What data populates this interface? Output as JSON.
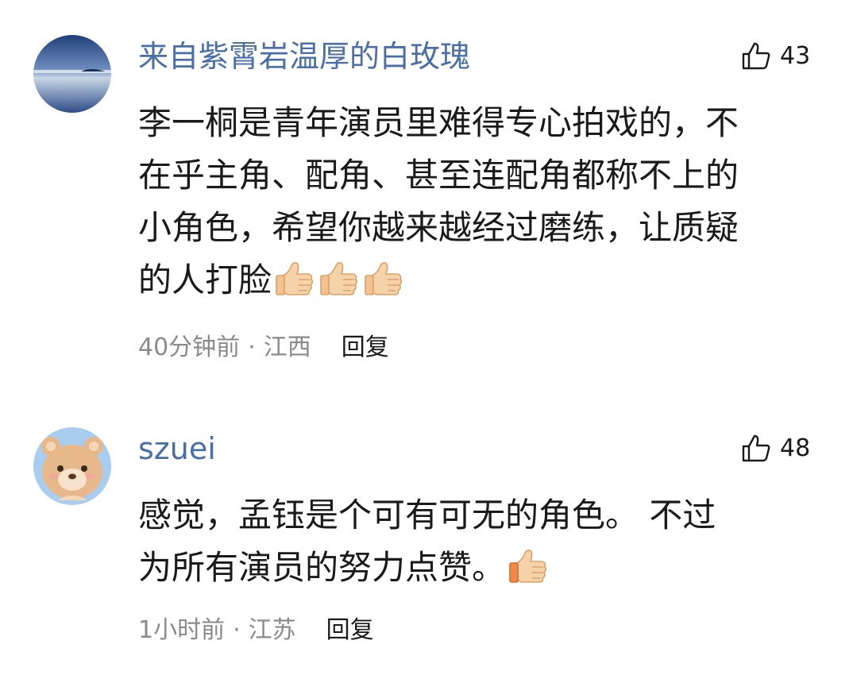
{
  "comments": [
    {
      "username": "来自紫霄岩温厚的白玫瑰",
      "likes": "43",
      "lines": [
        "李一桐是青年演员里难得专心拍戏的，不",
        "在乎主角、配角、甚至连配角都称不上的",
        "小角色，希望你越来越经过磨练，让质疑",
        "的人打脸"
      ],
      "emoji": "thumbs-up-icon",
      "emoji_count": 3,
      "time": "40分钟前",
      "dot": "·",
      "location": "江西",
      "reply": "回复"
    },
    {
      "username": "szuei",
      "likes": "48",
      "lines": [
        "感觉，孟钰是个可有可无的角色。 不过",
        "为所有演员的努力点赞。"
      ],
      "emoji": "thumbs-up-icon",
      "emoji_count": 1,
      "time": "1小时前",
      "dot": "·",
      "location": "江苏",
      "reply": "回复"
    }
  ],
  "colors": {
    "username": "#4a6fa8",
    "meta": "#8a8a8a",
    "text": "#1a1a1a"
  }
}
